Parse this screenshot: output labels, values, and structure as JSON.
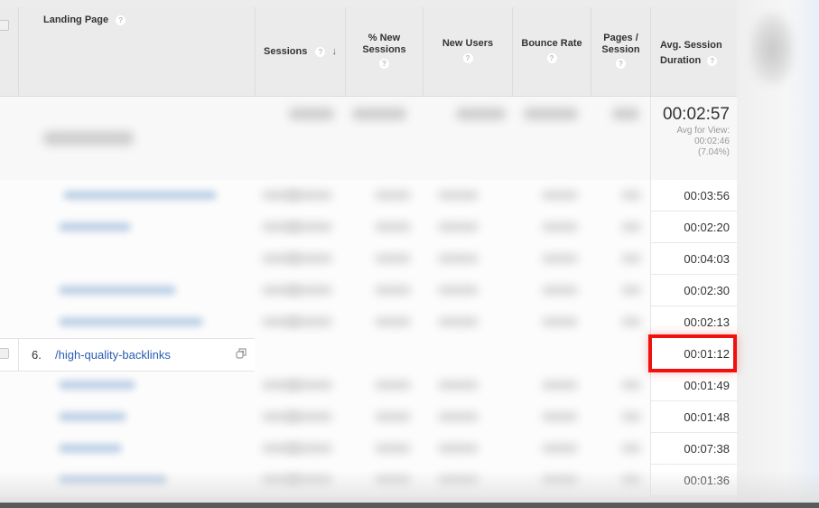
{
  "table": {
    "columns": {
      "landing_page": "Landing Page",
      "sessions": "Sessions",
      "pct_new_sessions_line1": "% New",
      "pct_new_sessions_line2": "Sessions",
      "new_users": "New Users",
      "bounce_rate": "Bounce Rate",
      "pages_session_line1": "Pages /",
      "pages_session_line2": "Session",
      "avg_session_duration_line1": "Avg. Session",
      "avg_session_duration_line2": "Duration"
    },
    "help_glyph": "?",
    "sort_icon": "↓",
    "summary": {
      "avg_session_duration": "00:02:57",
      "avg_for_view_label": "Avg for View:",
      "avg_for_view_value": "00:02:46",
      "avg_for_view_delta": "(7.04%)"
    },
    "highlighted_row": {
      "index": "6.",
      "landing_page": "/high-quality-backlinks",
      "avg_session_duration": "00:01:12"
    },
    "avg_session_durations": [
      "00:03:56",
      "00:02:20",
      "00:04:03",
      "00:02:30",
      "00:02:13",
      "00:01:12",
      "00:01:49",
      "00:01:48",
      "00:07:38",
      "00:01:36"
    ]
  },
  "colors": {
    "highlight_box": "#f01010",
    "link": "#2a5db0"
  }
}
